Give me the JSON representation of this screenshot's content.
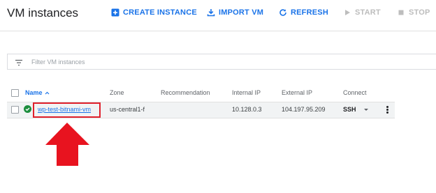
{
  "header": {
    "title": "VM instances",
    "actions": [
      {
        "label": "CREATE INSTANCE",
        "icon": "add-box-icon",
        "enabled": true
      },
      {
        "label": "IMPORT VM",
        "icon": "download-icon",
        "enabled": true
      },
      {
        "label": "REFRESH",
        "icon": "refresh-icon",
        "enabled": true
      },
      {
        "label": "START",
        "icon": "play-icon",
        "enabled": false
      },
      {
        "label": "STOP",
        "icon": "stop-icon",
        "enabled": false
      }
    ]
  },
  "filter": {
    "placeholder": "Filter VM instances",
    "value": "",
    "icon": "filter-icon"
  },
  "table": {
    "columns": {
      "name": "Name",
      "zone": "Zone",
      "recommendation": "Recommendation",
      "internal_ip": "Internal IP",
      "external_ip": "External IP",
      "connect": "Connect"
    },
    "sort": "ascending",
    "rows": [
      {
        "status": "running",
        "name": "wp-test-bitnami-vm",
        "zone": "us-central1-f",
        "recommendation": "",
        "internal_ip": "10.128.0.3",
        "external_ip": "104.197.95.209",
        "connect": "SSH"
      }
    ]
  },
  "annotation": {
    "highlight_color": "#e0202b",
    "arrow_color": "#e8131f"
  },
  "colors": {
    "accent": "#1a73e8",
    "status_running": "#1e8e3e",
    "disabled": "#bdbdbd"
  }
}
